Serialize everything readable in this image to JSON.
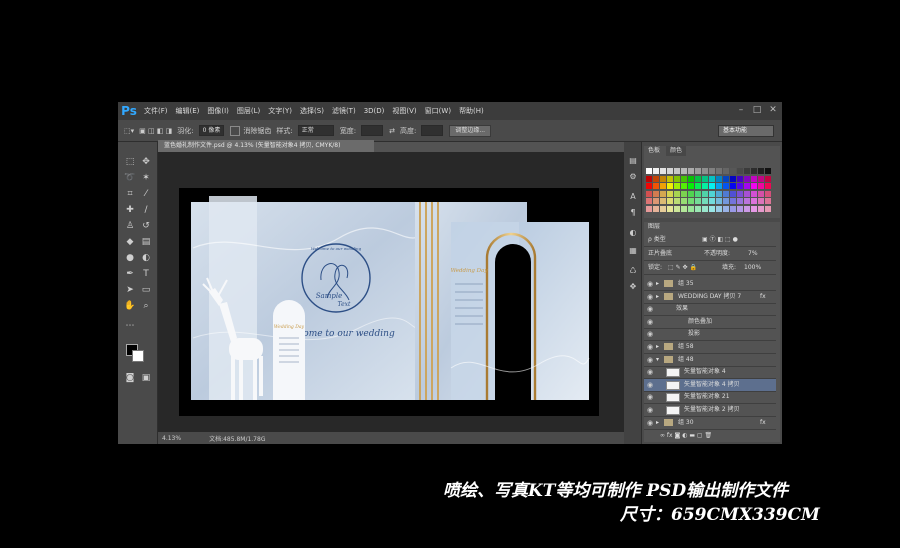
{
  "app": {
    "logo": "Ps"
  },
  "menu": [
    "文件(F)",
    "编辑(E)",
    "图像(I)",
    "图层(L)",
    "文字(Y)",
    "选择(S)",
    "滤镜(T)",
    "3D(D)",
    "视图(V)",
    "窗口(W)",
    "帮助(H)"
  ],
  "options": {
    "feather_label": "羽化:",
    "feather_value": "0 像素",
    "antialias_label": "消除锯齿",
    "style_label": "样式:",
    "style_value": "正常",
    "width_label": "宽度:",
    "height_label": "高度:",
    "refine_button": "调整边缘...",
    "workspace": "基本功能"
  },
  "document": {
    "tab_title": "蓝色婚礼制作文件.psd @ 4.13% (矢量智能对象4 拷贝, CMYK/8)",
    "zoom": "4.13%",
    "doc_size": "文档:485.8M/1.78G"
  },
  "artwork": {
    "welcome": "Welcome to our wedding",
    "sample": "Sample",
    "text": "Text",
    "wedding_day": "Wedding Day",
    "script_heading": "ome to our wedding"
  },
  "panels": {
    "swatch_tabs": [
      "色板",
      "颜色"
    ],
    "layers_tab": "图层",
    "kind": "ρ 类型",
    "blend_mode": "正片叠底",
    "opacity_label": "不透明度:",
    "opacity_value": "7%",
    "lock_label": "锁定:",
    "fill_label": "填充:",
    "fill_value": "100%",
    "layers": [
      {
        "type": "folder",
        "label": "组 35"
      },
      {
        "type": "folder-fx",
        "label": "WEDDING DAY 拷贝 7",
        "fx": "fx"
      },
      {
        "type": "effect",
        "label": "效果"
      },
      {
        "type": "effect",
        "label": "颜色叠加"
      },
      {
        "type": "effect",
        "label": "投影"
      },
      {
        "type": "folder",
        "label": "组 58"
      },
      {
        "type": "folder-open",
        "label": "组 48"
      },
      {
        "type": "layer",
        "label": "矢量智能对象 4"
      },
      {
        "type": "layer-selected",
        "label": "矢量智能对象 4 拷贝"
      },
      {
        "type": "layer",
        "label": "矢量智能对象 21"
      },
      {
        "type": "layer",
        "label": "矢量智能对象 2 拷贝"
      },
      {
        "type": "folder-fx",
        "label": "组 30",
        "fx": "fx"
      }
    ]
  },
  "promo": {
    "line1": "喷绘、写真KT等均可制作  PSD输出制作文件",
    "line2": "尺寸：659CMX339CM"
  },
  "colors": {
    "accent_blue": "#31a8ff",
    "gold": "#c89b4a",
    "marble": "#c3d3e5",
    "navy_line": "#2d4f86"
  },
  "icons": [
    "marquee-icon",
    "move-icon",
    "lasso-icon",
    "magic-wand-icon",
    "crop-icon",
    "eyedropper-icon",
    "healing-icon",
    "brush-icon",
    "stamp-icon",
    "history-brush-icon",
    "eraser-icon",
    "gradient-icon",
    "blur-icon",
    "dodge-icon",
    "pen-icon",
    "type-icon",
    "path-select-icon",
    "shape-icon",
    "hand-icon",
    "zoom-icon"
  ]
}
